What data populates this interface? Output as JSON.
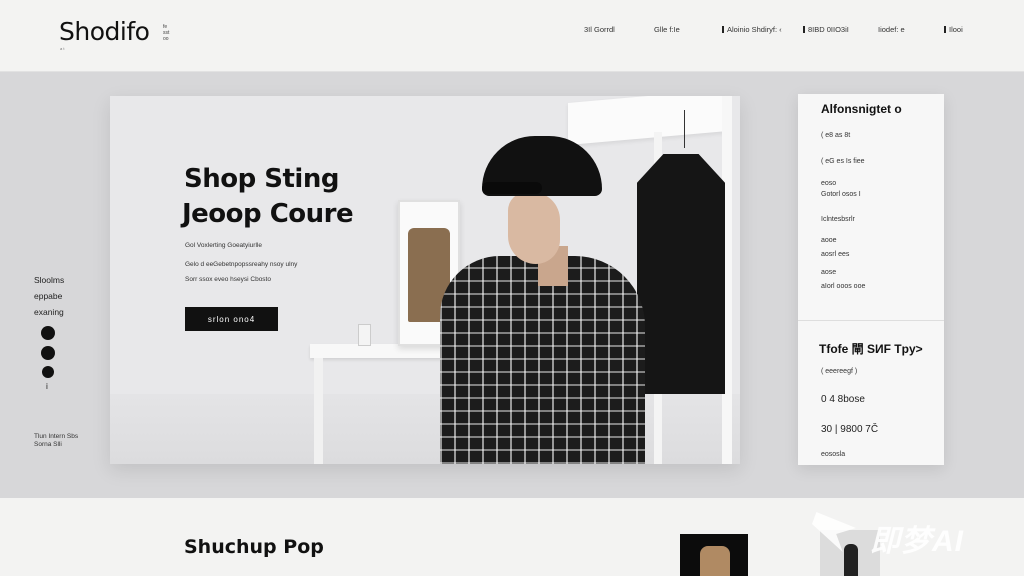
{
  "brand": {
    "name": "Shodifo",
    "tagline_line1": "fe",
    "tagline_line2": "sst",
    "tagline_line3": "oo",
    "sub": "a t"
  },
  "nav": {
    "items": [
      {
        "label": "3Il Gorrdl"
      },
      {
        "label": "Glle f:Ie"
      },
      {
        "label": "Aloinio Shdiryf: ‹"
      },
      {
        "label": "8IBD 0IIO3iI"
      },
      {
        "label": "Iiodef: e"
      },
      {
        "label": "Ilooi"
      }
    ]
  },
  "side_menu": {
    "items": [
      "Sloolms",
      "eppabe",
      "exaning"
    ],
    "last_label": "i",
    "footer_line1": "Tlun Intern Sbs",
    "footer_line2": "Sorna Slli"
  },
  "hero": {
    "title_line1": "Shop Sting",
    "title_line2": "Jeoop Coure",
    "subtitle": "Gol Voxlerting Goeatyiurlle",
    "body_line1": "Gelo d eeGebetnpopssreahy nsoy ulny",
    "body_line2": "Sorr ssox eveo hseysi Cbosto",
    "cta_label": "srlon  ono4"
  },
  "panel": {
    "heading": "Alfonsnigtet o",
    "rows": [
      "( e8 as 8t",
      "( eG es Is fiee",
      "eoso",
      "Gotorl osos I",
      "Iclntesbsrlr",
      "aooe",
      "aosrl ees",
      "aose",
      "aIorl ooos ooe"
    ],
    "heading2": "Tfofe 閘 SИF Tpy>",
    "rows2": [
      "( eeereegf )",
      "0 4 8bose",
      "30 | 9800 7Č",
      "eososla"
    ]
  },
  "bottom": {
    "title": "Shuchup Pop",
    "watermark": "即梦AI"
  }
}
